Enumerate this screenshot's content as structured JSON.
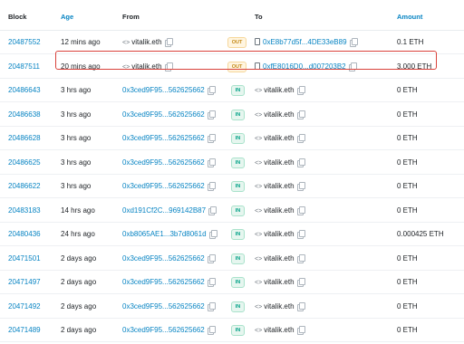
{
  "table": {
    "headers": {
      "block": "Block",
      "age": "Age",
      "from": "From",
      "to": "To",
      "amount": "Amount"
    },
    "rows": [
      {
        "block": "20487552",
        "age": "12 mins ago",
        "from": "vitalik.eth",
        "direction": "OUT",
        "to": "0xE8b77d5f...4DE33eB89",
        "amount": "0.1 ETH"
      },
      {
        "block": "20487511",
        "age": "20 mins ago",
        "from": "vitalik.eth",
        "direction": "OUT",
        "to": "0xfE8016D0...d007203B2",
        "amount": "3,000 ETH"
      },
      {
        "block": "20486643",
        "age": "3 hrs ago",
        "from": "0x3ced9F95...562625662",
        "direction": "IN",
        "to": "vitalik.eth",
        "amount": "0 ETH"
      },
      {
        "block": "20486638",
        "age": "3 hrs ago",
        "from": "0x3ced9F95...562625662",
        "direction": "IN",
        "to": "vitalik.eth",
        "amount": "0 ETH"
      },
      {
        "block": "20486628",
        "age": "3 hrs ago",
        "from": "0x3ced9F95...562625662",
        "direction": "IN",
        "to": "vitalik.eth",
        "amount": "0 ETH"
      },
      {
        "block": "20486625",
        "age": "3 hrs ago",
        "from": "0x3ced9F95...562625662",
        "direction": "IN",
        "to": "vitalik.eth",
        "amount": "0 ETH"
      },
      {
        "block": "20486622",
        "age": "3 hrs ago",
        "from": "0x3ced9F95...562625662",
        "direction": "IN",
        "to": "vitalik.eth",
        "amount": "0 ETH"
      },
      {
        "block": "20483183",
        "age": "14 hrs ago",
        "from": "0xd191Cf2C...969142B87",
        "direction": "IN",
        "to": "vitalik.eth",
        "amount": "0 ETH"
      },
      {
        "block": "20480436",
        "age": "24 hrs ago",
        "from": "0xb8065AE1...3b7d8061d",
        "direction": "IN",
        "to": "vitalik.eth",
        "amount": "0.000425 ETH"
      },
      {
        "block": "20471501",
        "age": "2 days ago",
        "from": "0x3ced9F95...562625662",
        "direction": "IN",
        "to": "vitalik.eth",
        "amount": "0 ETH"
      },
      {
        "block": "20471497",
        "age": "2 days ago",
        "from": "0x3ced9F95...562625662",
        "direction": "IN",
        "to": "vitalik.eth",
        "amount": "0 ETH"
      },
      {
        "block": "20471492",
        "age": "2 days ago",
        "from": "0x3ced9F95...562625662",
        "direction": "IN",
        "to": "vitalik.eth",
        "amount": "0 ETH"
      },
      {
        "block": "20471489",
        "age": "2 days ago",
        "from": "0x3ced9F95...562625662",
        "direction": "IN",
        "to": "vitalik.eth",
        "amount": "0 ETH"
      }
    ]
  },
  "icons": {
    "copy": "copy-icon",
    "ens": "ens-icon",
    "contract": "contract-document-icon"
  },
  "colors": {
    "link": "#0784c3",
    "out_badge": "#c48a19",
    "in_badge": "#00a186",
    "highlight": "#d9423b"
  }
}
